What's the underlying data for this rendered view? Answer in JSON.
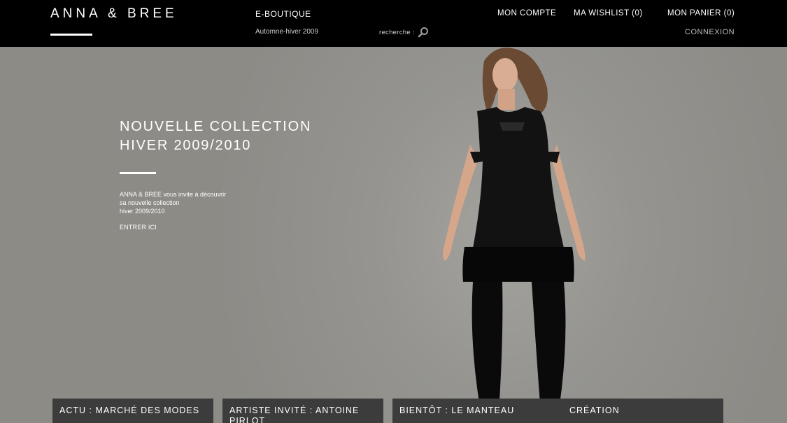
{
  "header": {
    "logo": "ANNA & BREE",
    "eboutique": "E-BOUTIQUE",
    "season": "Automne-hiver 2009",
    "search_label": "recherche :",
    "account": "MON COMPTE",
    "wishlist": "MA WISHLIST  (0)",
    "cart": "MON PANIER (0)",
    "login": "CONNEXION"
  },
  "hero": {
    "title_line1": "NOUVELLE COLLECTION",
    "title_line2": "HIVER 2009/2010",
    "text_line1": "ANNA & BREE vous invite à découvrir",
    "text_line2": "sa nouvelle collection",
    "text_line3": "hiver 2009/2010",
    "cta": "ENTRER ICI"
  },
  "tabs": [
    {
      "label": "ACTU : MARCHÉ DES MODES"
    },
    {
      "label": "ARTISTE INVITÉ : ANTOINE PIRLOT"
    },
    {
      "label": "BIENTÔT : LE MANTEAU"
    },
    {
      "label": "CRÉATION"
    }
  ],
  "colors": {
    "header_bg": "#000000",
    "hero_bg": "#959490",
    "tab_bg": "#3c3c3c"
  },
  "icons": {
    "search": "magnifier-icon"
  }
}
